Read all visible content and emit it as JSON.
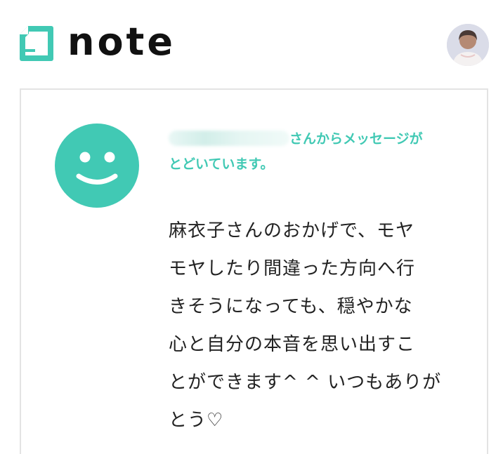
{
  "header": {
    "logo_text": "note",
    "avatar_alt": "user-avatar"
  },
  "colors": {
    "accent": "#41c9b4",
    "text": "#222222",
    "border": "#e3e3e3"
  },
  "notification": {
    "sender_suffix": "さんからメッセージが",
    "line2": "とどいています。",
    "icon": "smiley-icon"
  },
  "message": {
    "lines": [
      "麻衣子さんのおかげで、モヤ",
      "モヤしたり間違った方向へ行",
      "きそうになっても、穏やかな",
      "心と自分の本音を思い出すこ",
      "とができます^ ^ いつもありが",
      "とう♡"
    ]
  }
}
